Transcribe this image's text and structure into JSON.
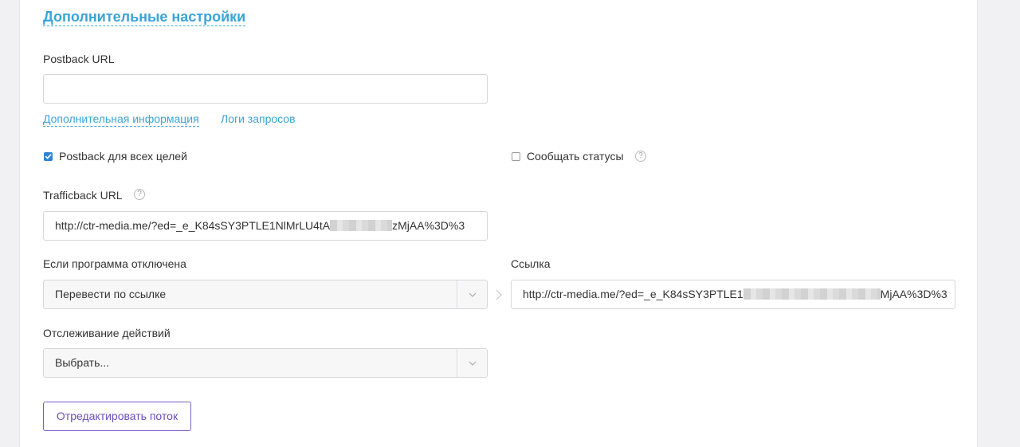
{
  "section": {
    "title": "Дополнительные настройки"
  },
  "postback": {
    "label": "Postback URL",
    "value": "",
    "placeholder": "",
    "more_info_link": "Дополнительная информация",
    "logs_link": "Логи запросов"
  },
  "checkboxes": {
    "all_goals": {
      "label": "Postback для всех целей",
      "checked": true
    },
    "report_statuses": {
      "label": "Сообщать статусы",
      "checked": false
    }
  },
  "trafficback": {
    "label": "Trafficback URL",
    "value_start": "http://ctr-media.me/?ed=_e_K84sSY3PTLE1NlMrLU4tA",
    "value_end": "zMjAA%3D%3"
  },
  "if_disabled": {
    "label": "Если программа отключена",
    "selected": "Перевести по ссылке"
  },
  "link_field": {
    "label": "Ссылка",
    "value_start": "http://ctr-media.me/?ed=_e_K84sSY3PTLE1",
    "value_end": "MjAA%3D%3"
  },
  "tracking": {
    "label": "Отслеживание действий",
    "selected": "Выбрать..."
  },
  "actions": {
    "edit_stream_label": "Отредактировать поток"
  },
  "icons": {
    "help": "?",
    "help_icon": "question-circle-icon",
    "chevron": "chevron-down-icon",
    "arrow": "chevron-right-icon"
  },
  "colors": {
    "accent_blue": "#3aa4d9",
    "checkbox_blue": "#2f84d6",
    "button_purple": "#6b4fbd"
  }
}
